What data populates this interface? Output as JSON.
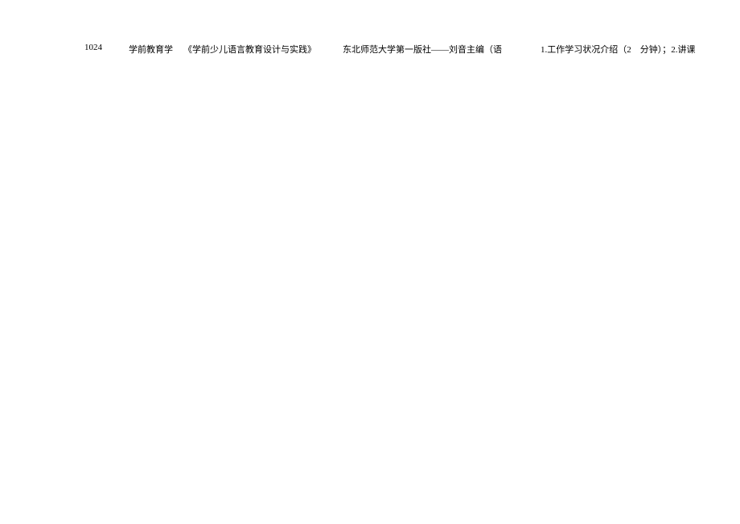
{
  "row": {
    "id": "1024",
    "major": "学前教育学",
    "title": "《学前少儿语言教育设计与实践》",
    "publisher": "东北师范大学第一版社——刘音主编（语",
    "description": "1.工作学习状况介绍（2　分钟）；2.讲课"
  }
}
